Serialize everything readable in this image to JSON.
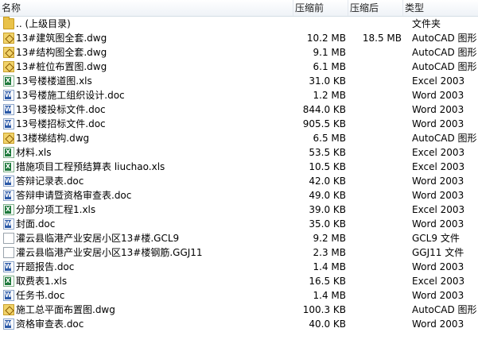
{
  "columns": {
    "name": "名称",
    "compressed_size": "压缩前",
    "size": "压缩后",
    "type": "类型"
  },
  "rows": [
    {
      "name": ".. (上级目录)",
      "compressed_size": "",
      "size": "",
      "type": "文件夹",
      "icon": "folder-icon"
    },
    {
      "name": "13#建筑图全套.dwg",
      "compressed_size": "10.2 MB",
      "size": "18.5 MB",
      "type": "AutoCAD 图形",
      "icon": "dwg-icon"
    },
    {
      "name": "13#结构图全套.dwg",
      "compressed_size": "9.1 MB",
      "size": "",
      "type": "AutoCAD 图形",
      "icon": "dwg-icon"
    },
    {
      "name": "13#桩位布置图.dwg",
      "compressed_size": "6.1 MB",
      "size": "",
      "type": "AutoCAD 图形",
      "icon": "dwg-icon"
    },
    {
      "name": "13号楼楼道图.xls",
      "compressed_size": "31.0 KB",
      "size": "",
      "type": "Excel 2003",
      "icon": "xls-icon"
    },
    {
      "name": "13号楼施工组织设计.doc",
      "compressed_size": "1.2 MB",
      "size": "",
      "type": "Word 2003",
      "icon": "doc-icon"
    },
    {
      "name": "13号楼投标文件.doc",
      "compressed_size": "844.0 KB",
      "size": "",
      "type": "Word 2003",
      "icon": "doc-icon"
    },
    {
      "name": "13号楼招标文件.doc",
      "compressed_size": "905.5 KB",
      "size": "",
      "type": "Word 2003",
      "icon": "doc-icon"
    },
    {
      "name": "13楼梯结构.dwg",
      "compressed_size": "6.5 MB",
      "size": "",
      "type": "AutoCAD 图形",
      "icon": "dwg-icon"
    },
    {
      "name": "材料.xls",
      "compressed_size": "53.5 KB",
      "size": "",
      "type": "Excel 2003",
      "icon": "xls-icon"
    },
    {
      "name": "措施项目工程预结算表 liuchao.xls",
      "compressed_size": "10.5 KB",
      "size": "",
      "type": "Excel 2003",
      "icon": "xls-icon"
    },
    {
      "name": "答辩记录表.doc",
      "compressed_size": "42.0 KB",
      "size": "",
      "type": "Word 2003",
      "icon": "doc-icon"
    },
    {
      "name": "答辩申请暨资格审查表.doc",
      "compressed_size": "49.0 KB",
      "size": "",
      "type": "Word 2003",
      "icon": "doc-icon"
    },
    {
      "name": "分部分项工程1.xls",
      "compressed_size": "39.0 KB",
      "size": "",
      "type": "Excel 2003",
      "icon": "xls-icon"
    },
    {
      "name": "封面.doc",
      "compressed_size": "35.0 KB",
      "size": "",
      "type": "Word 2003",
      "icon": "doc-icon"
    },
    {
      "name": "灌云县临港产业安居小区13#楼.GCL9",
      "compressed_size": "9.2 MB",
      "size": "",
      "type": "GCL9 文件",
      "icon": "file-icon"
    },
    {
      "name": "灌云县临港产业安居小区13#楼钢筋.GGJ11",
      "compressed_size": "2.3 MB",
      "size": "",
      "type": "GGJ11 文件",
      "icon": "file-icon"
    },
    {
      "name": "开题报告.doc",
      "compressed_size": "1.4 MB",
      "size": "",
      "type": "Word 2003",
      "icon": "doc-icon"
    },
    {
      "name": "取费表1.xls",
      "compressed_size": "16.5 KB",
      "size": "",
      "type": "Excel 2003",
      "icon": "xls-icon"
    },
    {
      "name": "任务书.doc",
      "compressed_size": "1.4 MB",
      "size": "",
      "type": "Word 2003",
      "icon": "doc-icon"
    },
    {
      "name": "施工总平面布置图.dwg",
      "compressed_size": "100.3 KB",
      "size": "",
      "type": "AutoCAD 图形",
      "icon": "dwg-icon"
    },
    {
      "name": "资格审查表.doc",
      "compressed_size": "40.0 KB",
      "size": "",
      "type": "Word 2003",
      "icon": "doc-icon"
    }
  ]
}
